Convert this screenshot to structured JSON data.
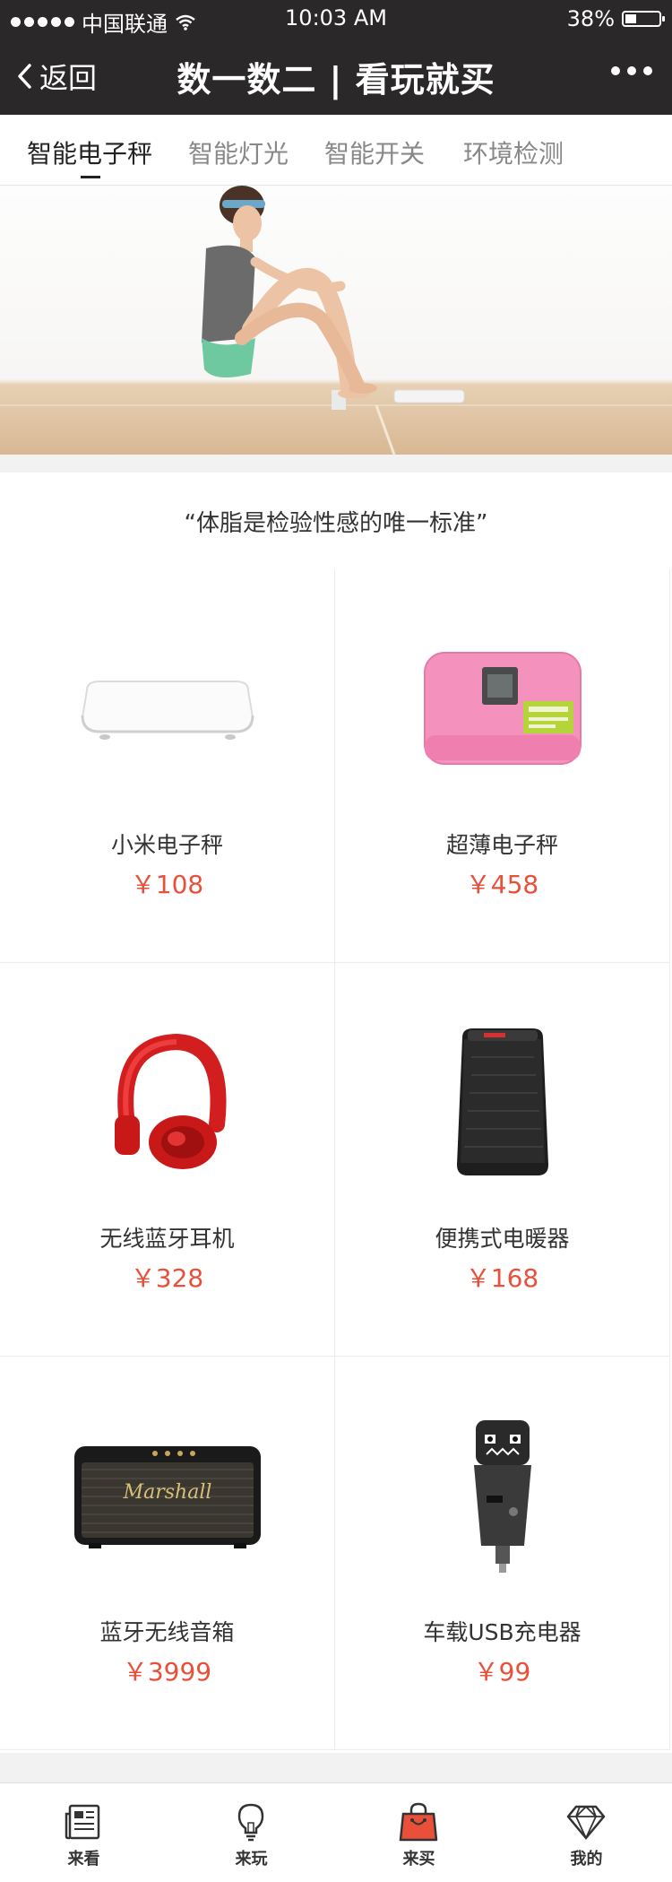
{
  "status_bar": {
    "carrier": "中国联通",
    "time": "10:03 AM",
    "battery": "38%"
  },
  "nav": {
    "back_label": "返回",
    "title": "数一数二 | 看玩就买"
  },
  "category_tabs": [
    {
      "label": "智能电子秤",
      "active": true
    },
    {
      "label": "智能灯光",
      "active": false
    },
    {
      "label": "智能开关",
      "active": false
    },
    {
      "label": "环境检测",
      "active": false
    }
  ],
  "quote": "“体脂是检验性感的唯一标准”",
  "products": [
    {
      "name": "小米电子秤",
      "price": "￥108",
      "icon": "white-scale"
    },
    {
      "name": "超薄电子秤",
      "price": "￥458",
      "icon": "pink-scale"
    },
    {
      "name": "无线蓝牙耳机",
      "price": "￥328",
      "icon": "red-headphones"
    },
    {
      "name": "便携式电暖器",
      "price": "￥168",
      "icon": "black-heater"
    },
    {
      "name": "蓝牙无线音箱",
      "price": "￥3999",
      "icon": "marshall-speaker"
    },
    {
      "name": "车载USB充电器",
      "price": "￥99",
      "icon": "car-charger"
    }
  ],
  "speaker_brand": "Marshall",
  "bottom_tabs": [
    {
      "label": "来看",
      "icon": "newspaper-icon"
    },
    {
      "label": "来玩",
      "icon": "lightbulb-icon"
    },
    {
      "label": "来买",
      "icon": "shopping-bag-icon",
      "accent": "#e8503a"
    },
    {
      "label": "我的",
      "icon": "diamond-icon"
    }
  ],
  "colors": {
    "header_bg": "#2a2828",
    "price": "#e8503a",
    "divider": "#ececec"
  }
}
